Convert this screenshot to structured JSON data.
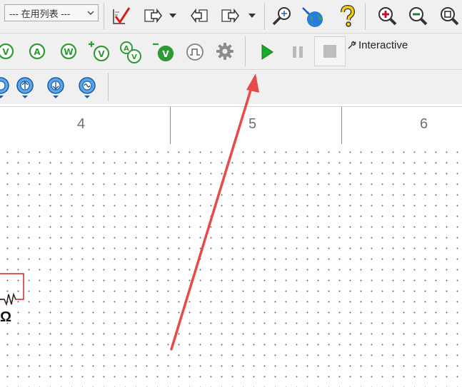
{
  "toolbar": {
    "list_select": {
      "value": "--- 在用列表 ---",
      "icon": "chevron-down-icon"
    },
    "row1_icons": [
      "check-icon",
      "arrow-out-icon",
      "arrow-in-icon",
      "arrow-out-icon",
      "probe-search-icon",
      "globe-icon",
      "help-icon",
      "zoom-in-icon",
      "zoom-out-icon",
      "zoom-fit-icon"
    ],
    "row2_instruments": [
      {
        "letter": "V"
      },
      {
        "letter": "A"
      },
      {
        "letter": "W"
      },
      {
        "letter": "V"
      },
      {
        "letter": "V"
      },
      {
        "letter": "V"
      },
      {
        "letter": ""
      }
    ],
    "simulation": {
      "run_icon": "play-icon",
      "pause_icon": "pause-icon",
      "stop_icon": "stop-icon",
      "mode_icon": "wrench-icon",
      "mode_label": "Interactive"
    }
  },
  "ruler": {
    "labels": [
      "4",
      "5",
      "6"
    ]
  },
  "canvas": {
    "component_label": "Ω"
  },
  "colors": {
    "accent_arrow": "#e84a4a",
    "run_green": "#1bab2c",
    "instrument_green": "#2f9a36",
    "grid_dot": "#6a6a6a"
  }
}
